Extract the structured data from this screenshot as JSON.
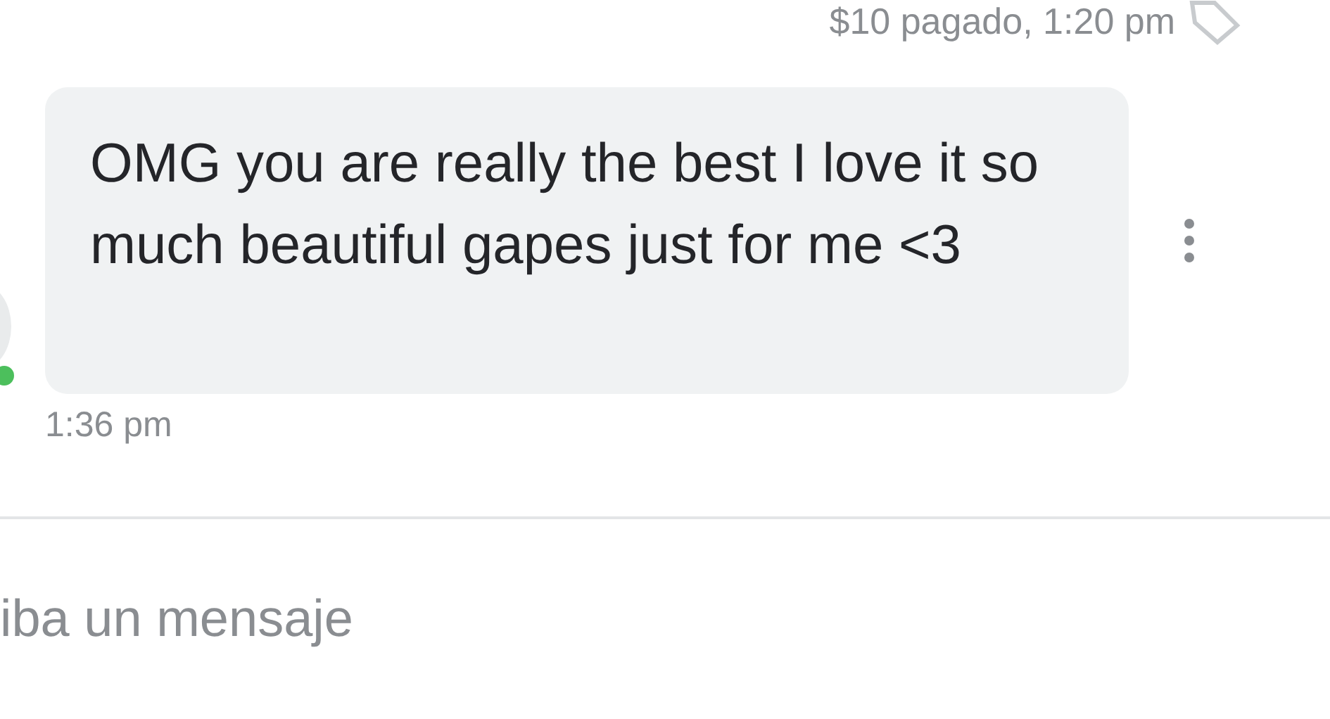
{
  "previous_message": {
    "meta": "$10 pagado, 1:20 pm"
  },
  "message": {
    "text": "OMG you are really the best I love it so much beautiful gapes just for me <3",
    "time": "1:36 pm",
    "sender_online": true
  },
  "composer": {
    "placeholder": "iba un mensaje"
  }
}
